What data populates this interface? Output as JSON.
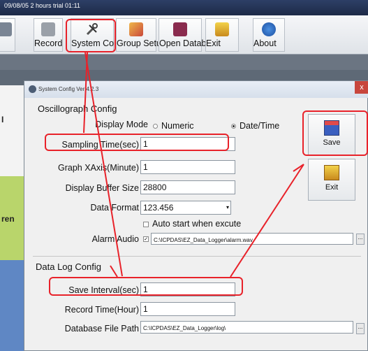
{
  "titlebar": {
    "text": "09/08/05  2 hours trial  01:11"
  },
  "toolbar": {
    "buttons": [
      {
        "label": ""
      },
      {
        "label": "Record"
      },
      {
        "label": "System Config"
      },
      {
        "label": "Group Setup"
      },
      {
        "label": "Open Database"
      },
      {
        "label": "Exit"
      },
      {
        "label": "About"
      }
    ]
  },
  "background": {
    "left_text": "I",
    "left_text2": "ren"
  },
  "dialog": {
    "title": "System Config Ver 4.2.3",
    "close": "x",
    "oscilloscope": {
      "title": "Oscillograph Config",
      "display_mode_label": "Display Mode",
      "radio_numeric": "Numeric",
      "radio_datetime": "Date/Time",
      "sampling_label": "Sampling Time(sec)",
      "sampling_value": "1",
      "graph_label": "Graph XAxis(Minute)",
      "graph_value": "1",
      "buffer_label": "Display Buffer Size",
      "buffer_value": "28800",
      "format_label": "Data Format",
      "format_value": "123.456",
      "autostart_label": "Auto start when excute",
      "alarm_label": "Alarm Audio",
      "alarm_check": "✓",
      "alarm_value": "C:\\ICPDAS\\EZ_Data_Logger\\alarm.wav"
    },
    "datalog": {
      "title": "Data Log Config",
      "save_label": "Save Interval(sec)",
      "save_value": "1",
      "record_label": "Record Time(Hour)",
      "record_value": "1",
      "dbpath_label": "Database File Path",
      "dbpath_value": "C:\\ICPDAS\\EZ_Data_Logger\\log\\"
    },
    "save_button": "Save",
    "exit_button": "Exit",
    "browse": "..."
  },
  "colors": {
    "highlight": "#e8222a"
  }
}
